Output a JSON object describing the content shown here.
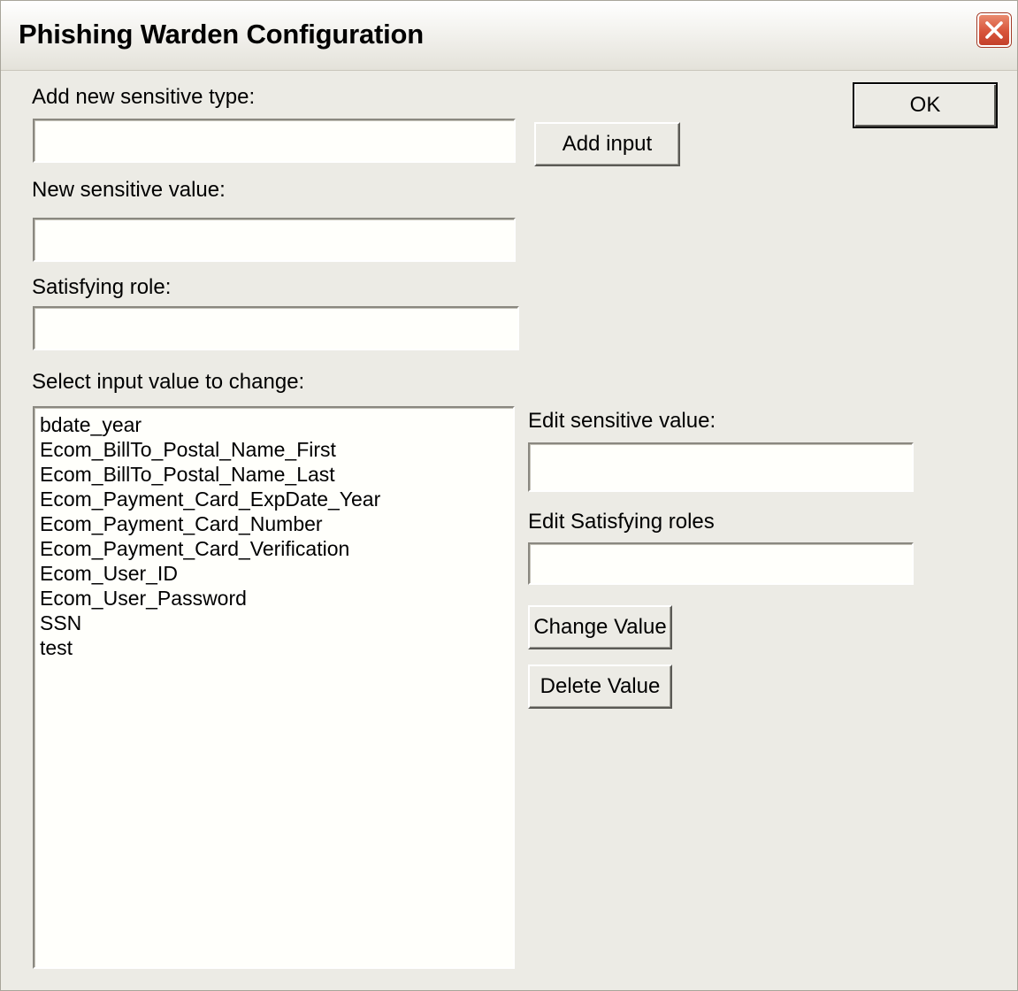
{
  "window": {
    "title": "Phishing Warden Configuration"
  },
  "icons": {
    "close": "close-icon"
  },
  "form": {
    "add_type_label": "Add new sensitive type:",
    "add_type_value": "",
    "add_input_button": "Add input",
    "new_value_label": "New sensitive value:",
    "new_value_value": "",
    "role_label": "Satisfying role:",
    "role_value": "",
    "ok_button": "OK"
  },
  "list": {
    "label": "Select input value to change:",
    "items": [
      "bdate_year",
      "Ecom_BillTo_Postal_Name_First",
      "Ecom_BillTo_Postal_Name_Last",
      "Ecom_Payment_Card_ExpDate_Year",
      "Ecom_Payment_Card_Number",
      "Ecom_Payment_Card_Verification",
      "Ecom_User_ID",
      "Ecom_User_Password",
      "SSN",
      "test"
    ]
  },
  "edit": {
    "value_label": "Edit sensitive value:",
    "value_value": "",
    "roles_label": "Edit Satisfying roles",
    "roles_value": "",
    "change_button": "Change Value",
    "delete_button": "Delete Value"
  }
}
